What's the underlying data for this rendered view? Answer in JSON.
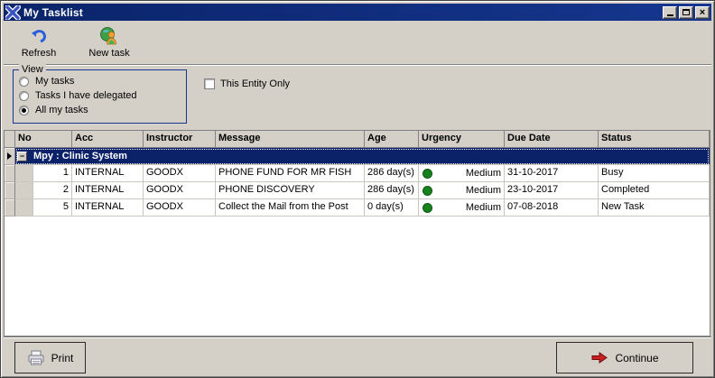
{
  "window": {
    "title": "My Tasklist",
    "controls": {
      "minimize": "minimize",
      "maximize": "maximize",
      "close": "×"
    }
  },
  "toolbar": {
    "refresh_label": "Refresh",
    "new_task_label": "New task"
  },
  "view_panel": {
    "legend": "View",
    "options": [
      {
        "label": "My tasks",
        "selected": false
      },
      {
        "label": "Tasks I have delegated",
        "selected": false
      },
      {
        "label": "All my tasks",
        "selected": true
      }
    ]
  },
  "entity_checkbox": {
    "label": "This Entity Only",
    "checked": false
  },
  "grid": {
    "columns": [
      "No",
      "Acc",
      "Instructor",
      "Message",
      "Age",
      "Urgency",
      "Due Date",
      "Status"
    ],
    "group_row": {
      "label": "Mpy : Clinic System",
      "collapse_glyph": "−",
      "selected": true
    },
    "rows": [
      {
        "no": "1",
        "acc": "INTERNAL",
        "instructor": "GOODX",
        "message": "PHONE FUND FOR MR FISH",
        "age": "286 day(s)",
        "urgency": "Medium",
        "due_date": "31-10-2017",
        "status": "Busy"
      },
      {
        "no": "2",
        "acc": "INTERNAL",
        "instructor": "GOODX",
        "message": "PHONE DISCOVERY",
        "age": "286 day(s)",
        "urgency": "Medium",
        "due_date": "23-10-2017",
        "status": "Completed"
      },
      {
        "no": "5",
        "acc": "INTERNAL",
        "instructor": "GOODX",
        "message": "Collect the Mail from the Post",
        "age": "0 day(s)",
        "urgency": "Medium",
        "due_date": "07-08-2018",
        "status": "New Task"
      }
    ]
  },
  "footer": {
    "print_label": "Print",
    "continue_label": "Continue"
  },
  "icons": {
    "app": "x-logo",
    "refresh": "blue-undo-arrow",
    "new_task": "globe-with-person",
    "print": "printer",
    "continue": "red-right-arrow",
    "urgency": "green-dot"
  },
  "colors": {
    "titlebar": "#0a246a",
    "dialog_bg": "#d4d0c8",
    "group_row_bg": "#0b2268",
    "urgency_dot": "#17811d",
    "continue_arrow": "#cc1f1f",
    "refresh_icon": "#2b5fd9"
  }
}
